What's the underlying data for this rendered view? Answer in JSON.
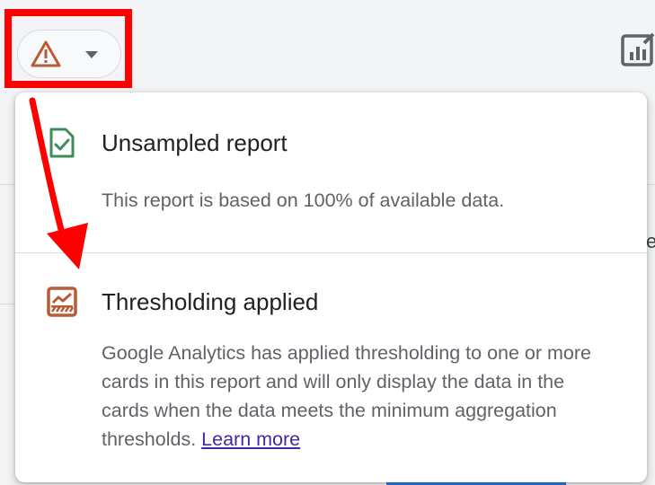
{
  "header": {
    "data_quality_icon": "warning-triangle-icon",
    "dropdown_icon": "caret-down-icon",
    "edit_report_icon": "edit-report-icon",
    "colors": {
      "warning": "#b85c38",
      "highlight": "#ff0000",
      "annotation_arrow": "#ff0000"
    }
  },
  "background": {
    "edge_char": "e"
  },
  "panel": {
    "sections": [
      {
        "icon": "check-document-icon",
        "icon_color": "#3d8c5a",
        "title": "Unsampled report",
        "body": "This report is based on 100% of available data."
      },
      {
        "icon": "thresholding-chart-icon",
        "icon_color": "#b85c38",
        "title": "Thresholding applied",
        "body": "Google Analytics has applied thresholding to one or more cards in this report and will only display the data in the cards when the data meets the minimum aggregation thresholds.",
        "link_label": "Learn more",
        "link_color": "#4527a0"
      }
    ]
  }
}
